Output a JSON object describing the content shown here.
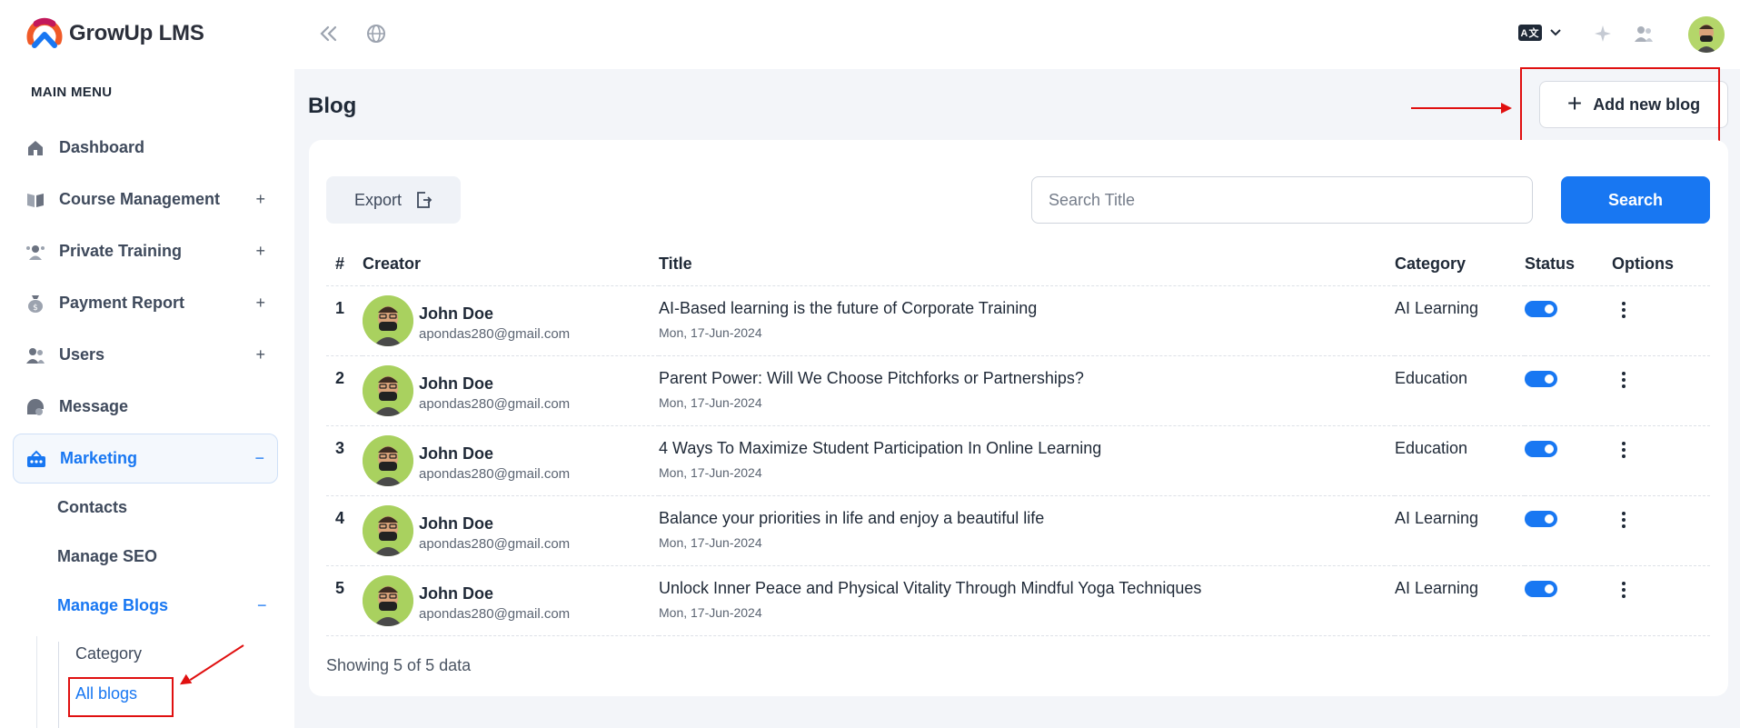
{
  "app": {
    "name": "GrowUp LMS"
  },
  "sidebar": {
    "menu_title": "MAIN MENU",
    "items": [
      {
        "label": "Dashboard",
        "icon": "home-icon",
        "toggle": ""
      },
      {
        "label": "Course Management",
        "icon": "book-icon",
        "toggle": "+"
      },
      {
        "label": "Private Training",
        "icon": "trainer-icon",
        "toggle": "+"
      },
      {
        "label": "Payment Report",
        "icon": "money-bag-icon",
        "toggle": "+"
      },
      {
        "label": "Users",
        "icon": "users-icon",
        "toggle": "+"
      },
      {
        "label": "Message",
        "icon": "message-icon",
        "toggle": ""
      },
      {
        "label": "Marketing",
        "icon": "marketing-icon",
        "toggle": "−"
      }
    ],
    "marketing_sub": {
      "contacts": "Contacts",
      "manage_seo": "Manage SEO",
      "manage_blogs": "Manage Blogs",
      "manage_blogs_toggle": "−"
    },
    "blogs_sub": {
      "category": "Category",
      "all_blogs": "All blogs"
    }
  },
  "topbar": {
    "language_code": "A文"
  },
  "page": {
    "title": "Blog",
    "add_button": "Add new blog",
    "export_label": "Export",
    "search_placeholder": "Search Title",
    "search_button": "Search",
    "footer": "Showing 5 of 5 data"
  },
  "table": {
    "headers": {
      "num": "#",
      "creator": "Creator",
      "title": "Title",
      "category": "Category",
      "status": "Status",
      "options": "Options"
    },
    "rows": [
      {
        "num": "1",
        "name": "John Doe",
        "email": "apondas280@gmail.com",
        "title": "AI-Based learning is the future of Corporate Training",
        "date": "Mon, 17-Jun-2024",
        "category": "AI Learning",
        "status_on": true
      },
      {
        "num": "2",
        "name": "John Doe",
        "email": "apondas280@gmail.com",
        "title": "Parent Power: Will We Choose Pitchforks or Partnerships?",
        "date": "Mon, 17-Jun-2024",
        "category": "Education",
        "status_on": true
      },
      {
        "num": "3",
        "name": "John Doe",
        "email": "apondas280@gmail.com",
        "title": "4 Ways To Maximize Student Participation In Online Learning",
        "date": "Mon, 17-Jun-2024",
        "category": "Education",
        "status_on": true
      },
      {
        "num": "4",
        "name": "John Doe",
        "email": "apondas280@gmail.com",
        "title": "Balance your priorities in life and enjoy a beautiful life",
        "date": "Mon, 17-Jun-2024",
        "category": "AI Learning",
        "status_on": true
      },
      {
        "num": "5",
        "name": "John Doe",
        "email": "apondas280@gmail.com",
        "title": "Unlock Inner Peace and Physical Vitality Through Mindful Yoga Techniques",
        "date": "Mon, 17-Jun-2024",
        "category": "AI Learning",
        "status_on": true
      }
    ]
  },
  "colors": {
    "accent": "#1877f2",
    "annotation_red": "#e01010",
    "page_bg": "#f3f5f9"
  }
}
